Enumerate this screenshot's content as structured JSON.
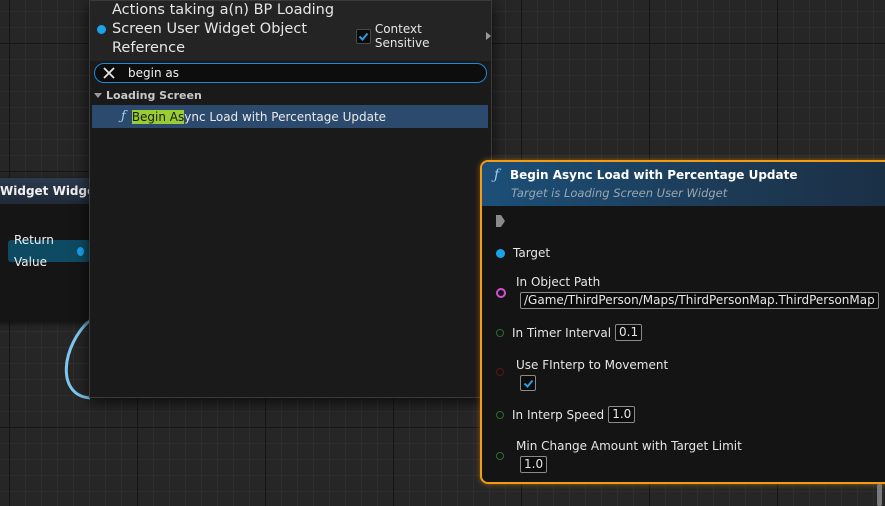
{
  "left_node": {
    "title": "Widget Widget",
    "return_label": "Return Value"
  },
  "action_menu": {
    "title": "Actions taking a(n) BP Loading Screen User Widget Object Reference",
    "context_sensitive": {
      "label": "Context Sensitive",
      "checked": true
    },
    "search": {
      "value": "begin as",
      "placeholder": ""
    },
    "category": "Loading Screen",
    "result": {
      "icon": "function-icon",
      "highlight": "Begin As",
      "rest": "ync Load with Percentage Update"
    }
  },
  "node": {
    "icon": "function-icon",
    "title": "Begin Async Load with Percentage Update",
    "subtitle": "Target is Loading Screen User Widget",
    "pins": {
      "target": "Target",
      "in_object_path": "In Object Path",
      "in_object_path_value": "/Game/ThirdPerson/Maps/ThirdPersonMap.ThirdPersonMap",
      "in_timer_interval": "In Timer Interval",
      "in_timer_interval_value": "0.1",
      "use_finterp": "Use FInterp to Movement",
      "use_finterp_checked": true,
      "in_interp_speed": "In Interp Speed",
      "in_interp_speed_value": "1.0",
      "min_change": "Min Change Amount with Target Limit",
      "min_change_value": "1.0"
    }
  },
  "colors": {
    "selection_outline": "#f39c12",
    "object_pin": "#1aa3e8",
    "soft_path_pin": "#d54fd5",
    "float_pin": "#2f6b2f",
    "bool_pin": "#5a1818",
    "search_highlight": "#9acd32",
    "selected_row": "#2c4a6e"
  }
}
